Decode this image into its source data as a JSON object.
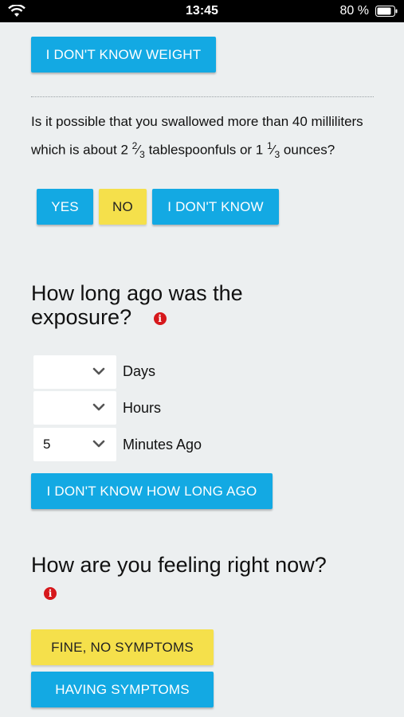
{
  "status": {
    "time": "13:45",
    "battery": "80 %"
  },
  "weight": {
    "unknown_button": "I DON'T KNOW WEIGHT"
  },
  "swallow_question": {
    "text_before_first_fraction": "Is it possible that you swallowed more than 40 milliliters which is about 2 ",
    "fraction1_num": "2",
    "fraction1_den": "3",
    "text_between_fractions": " tablespoonfuls or 1 ",
    "fraction2_num": "1",
    "fraction2_den": "3",
    "text_after": " ounces?",
    "yes_label": "YES",
    "no_label": "NO",
    "dont_know_label": "I DON'T KNOW"
  },
  "exposure": {
    "heading_line1": "How long ago was the",
    "heading_line2": "exposure?",
    "days": {
      "value": "",
      "label": "Days"
    },
    "hours": {
      "value": "",
      "label": "Hours"
    },
    "minutes": {
      "value": "5",
      "label": "Minutes Ago"
    },
    "unknown_button": "I DON'T KNOW HOW LONG AGO"
  },
  "feeling": {
    "heading": "How are you feeling right now?",
    "fine_label": "FINE, NO SYMPTOMS",
    "symptoms_label": "HAVING SYMPTOMS"
  },
  "colors": {
    "accent_blue": "#13a9e3",
    "highlight_yellow": "#f5e04b",
    "info_red": "#d6181c"
  },
  "icons": {
    "info": "info-icon",
    "chevron": "chevron-down-icon",
    "wifi": "wifi-icon",
    "battery": "battery-icon"
  }
}
